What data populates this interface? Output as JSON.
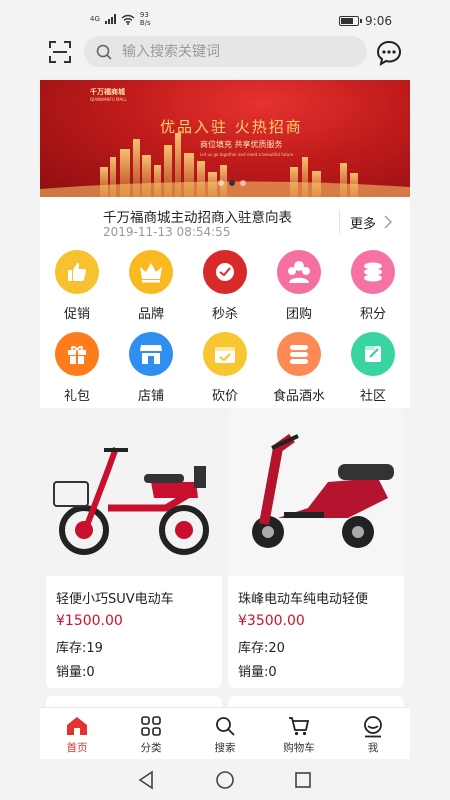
{
  "status_bar": {
    "network": "4G",
    "speed_value": "93",
    "speed_unit": "B/s",
    "time": "9:06"
  },
  "search": {
    "placeholder": "输入搜索关键词"
  },
  "banner": {
    "brand": "千万福商城",
    "brand_sub": "QIANWANFU MALL",
    "headline": "优品入驻 火热招商",
    "subline": "商位填充 共享优质服务",
    "tiny_text": "Let us go together and meet a beautiful future",
    "dot_count": 3,
    "active_dot": 1
  },
  "notice": {
    "title": "千万福商城主动招商入驻意向表",
    "date": "2019-11-13 08:54:55",
    "more_label": "更多"
  },
  "categories": [
    {
      "label": "促销",
      "icon": "thumbs-up-icon",
      "color": "#f7c12f"
    },
    {
      "label": "品牌",
      "icon": "crown-icon",
      "color": "#f9b921"
    },
    {
      "label": "秒杀",
      "icon": "clock-icon",
      "color": "#d92a2a"
    },
    {
      "label": "团购",
      "icon": "group-icon",
      "color": "#f56fa0"
    },
    {
      "label": "积分",
      "icon": "coins-icon",
      "color": "#f772a4"
    },
    {
      "label": "礼包",
      "icon": "gift-icon",
      "color": "#ff7c1c"
    },
    {
      "label": "店铺",
      "icon": "shop-icon",
      "color": "#2e8ff0"
    },
    {
      "label": "砍价",
      "icon": "calendar-icon",
      "color": "#f8c630"
    },
    {
      "label": "食品酒水",
      "icon": "food-icon",
      "color": "#fb8a54"
    },
    {
      "label": "社区",
      "icon": "community-icon",
      "color": "#38d4a1"
    }
  ],
  "products": [
    {
      "name": "轻便小巧SUV电动车",
      "price": "¥1500.00",
      "stock": "库存:19",
      "sales": "销量:0"
    },
    {
      "name": "珠峰电动车纯电动轻便",
      "price": "¥3500.00",
      "stock": "库存:20",
      "sales": "销量:0"
    }
  ],
  "tabs": [
    {
      "label": "首页",
      "icon": "home-icon",
      "active": true
    },
    {
      "label": "分类",
      "icon": "category-icon",
      "active": false
    },
    {
      "label": "搜索",
      "icon": "search-icon",
      "active": false
    },
    {
      "label": "购物车",
      "icon": "cart-icon",
      "active": false
    },
    {
      "label": "我",
      "icon": "user-icon",
      "active": false
    }
  ],
  "colors": {
    "accent": "#e3322f",
    "price": "#d0102c",
    "banner_red": "#bf1b1b"
  }
}
